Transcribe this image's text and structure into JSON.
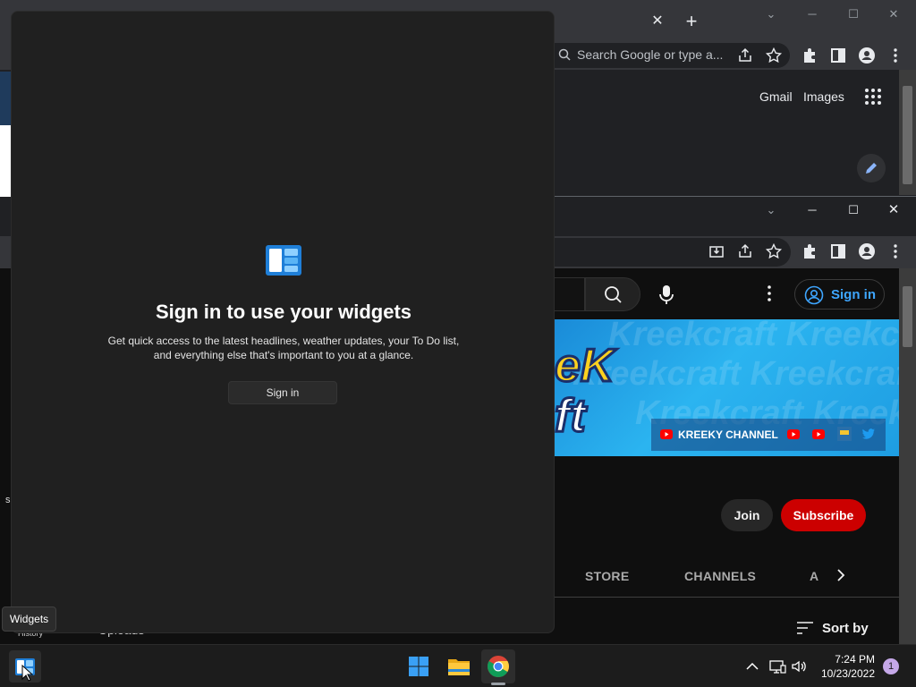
{
  "browser_top": {
    "tab_close_icon": "close-icon",
    "new_tab_icon": "plus-icon",
    "omnibox_placeholder": "Search Google or type a...",
    "links": {
      "gmail": "Gmail",
      "images": "Images"
    }
  },
  "youtube": {
    "sign_in": "Sign in",
    "channel_name": "KREEKY CHANNEL",
    "banner_logo_line1": "eK",
    "banner_logo_line2": "ft",
    "banner_watermark": "Kreekcraft Kreekcraft",
    "join": "Join",
    "subscribe": "Subscribe",
    "tabs": [
      "STORE",
      "CHANNELS",
      "A"
    ],
    "sort_by": "Sort by",
    "colors": {
      "subscribe": "#cc0000",
      "signin": "#3ea6ff"
    }
  },
  "behind_panel": {
    "letter": "s",
    "history": "History",
    "uploads": "Uploads"
  },
  "widgets": {
    "title": "Sign in to use your widgets",
    "description": "Get quick access to the latest headlines, weather updates, your To Do list, and everything else that's important to you at a glance.",
    "sign_in_button": "Sign in"
  },
  "tooltip": {
    "text": "Widgets"
  },
  "taskbar": {
    "time": "7:24 PM",
    "date": "10/23/2022",
    "notification_count": "1",
    "apps": [
      "start-icon",
      "file-explorer-icon",
      "chrome-icon"
    ]
  }
}
